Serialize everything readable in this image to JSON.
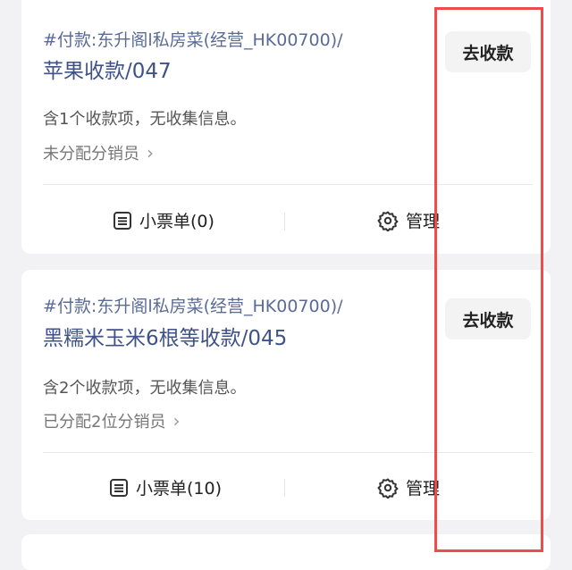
{
  "cards": [
    {
      "tag": "#付款:东升阁l私房菜(经营_HK00700)/",
      "title": "苹果收款/047",
      "description": "含1个收款项，无收集信息。",
      "assignment": "未分配分销员",
      "collect_label": "去收款",
      "receipt_label": "小票单(0)",
      "manage_label": "管理"
    },
    {
      "tag": "#付款:东升阁l私房菜(经营_HK00700)/",
      "title": "黑糯米玉米6根等收款/045",
      "description": "含2个收款项，无收集信息。",
      "assignment": "已分配2位分销员",
      "collect_label": "去收款",
      "receipt_label": "小票单(10)",
      "manage_label": "管理"
    }
  ],
  "colors": {
    "title": "#3f5288",
    "tag": "#5a6b96",
    "highlight_frame": "#ee4b4b",
    "background": "#f2f2f4"
  }
}
